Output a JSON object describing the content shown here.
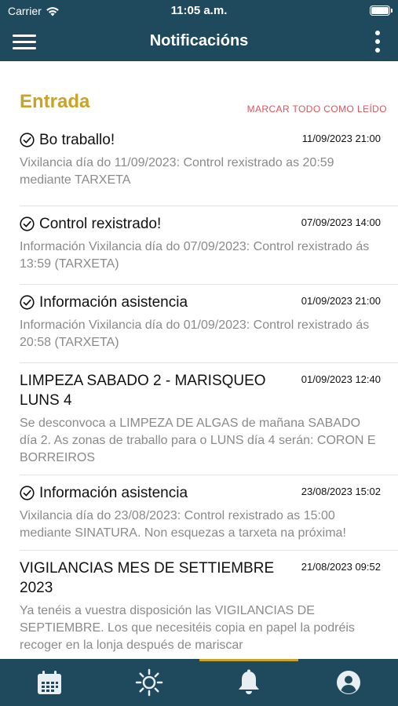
{
  "status": {
    "carrier": "Carrier",
    "time": "11:05 a.m."
  },
  "header": {
    "title": "Notificacións",
    "menu_icon": "hamburger-icon",
    "more_icon": "more-vertical-icon"
  },
  "inbox": {
    "title": "Entrada",
    "mark_all": "MARCAR TODO COMO LEÍDO"
  },
  "items": [
    {
      "title": "Bo traballo!",
      "date": "11/09/2023 21:00",
      "body": "Vixilancia día do 11/09/2023: Control rexistrado as 20:59 mediante TARXETA",
      "read": true
    },
    {
      "title": "Control rexistrado!",
      "date": "07/09/2023 14:00",
      "body": "Información Vixilancia día do 07/09/2023: Control rexistrado ás 13:59 (TARXETA)",
      "read": true
    },
    {
      "title": "Información asistencia",
      "date": "01/09/2023 21:00",
      "body": "Información Vixilancia día do 01/09/2023: Control rexistrado ás 20:58 (TARXETA)",
      "read": true
    },
    {
      "title": "LIMPEZA SABADO 2 - MARISQUEO LUNS 4",
      "date": "01/09/2023 12:40",
      "body": "Se desconvoca a LIMPEZA DE ALGAS de mañana SABADO día 2. As zonas de traballo para o LUNS día 4 serán: CORON E BORREIROS",
      "read": false
    },
    {
      "title": "Información asistencia",
      "date": "23/08/2023 15:02",
      "body": "Vixilancia día do 23/08/2023: Control rexistrado as 15:00 mediante SINATURA. Non esquezas a tarxeta na próxima!",
      "read": true
    },
    {
      "title": "VIGILANCIAS MES DE SETTIEMBRE 2023",
      "date": "21/08/2023 09:52",
      "body": "Ya tenéis a vuestra disposición las VIGILANCIAS DE SEPTIEMBRE. Los que necesitéis copia en papel la podréis recoger en la lonja después de mariscar",
      "read": false
    }
  ],
  "tabs": [
    {
      "icon": "calendar-icon",
      "active": false
    },
    {
      "icon": "sun-icon",
      "active": false
    },
    {
      "icon": "bell-icon",
      "active": true
    },
    {
      "icon": "profile-icon",
      "active": false
    }
  ],
  "colors": {
    "primary": "#1f4a5e",
    "accent": "#c9a227",
    "link": "#e0525a",
    "muted": "#8a8a8a"
  }
}
